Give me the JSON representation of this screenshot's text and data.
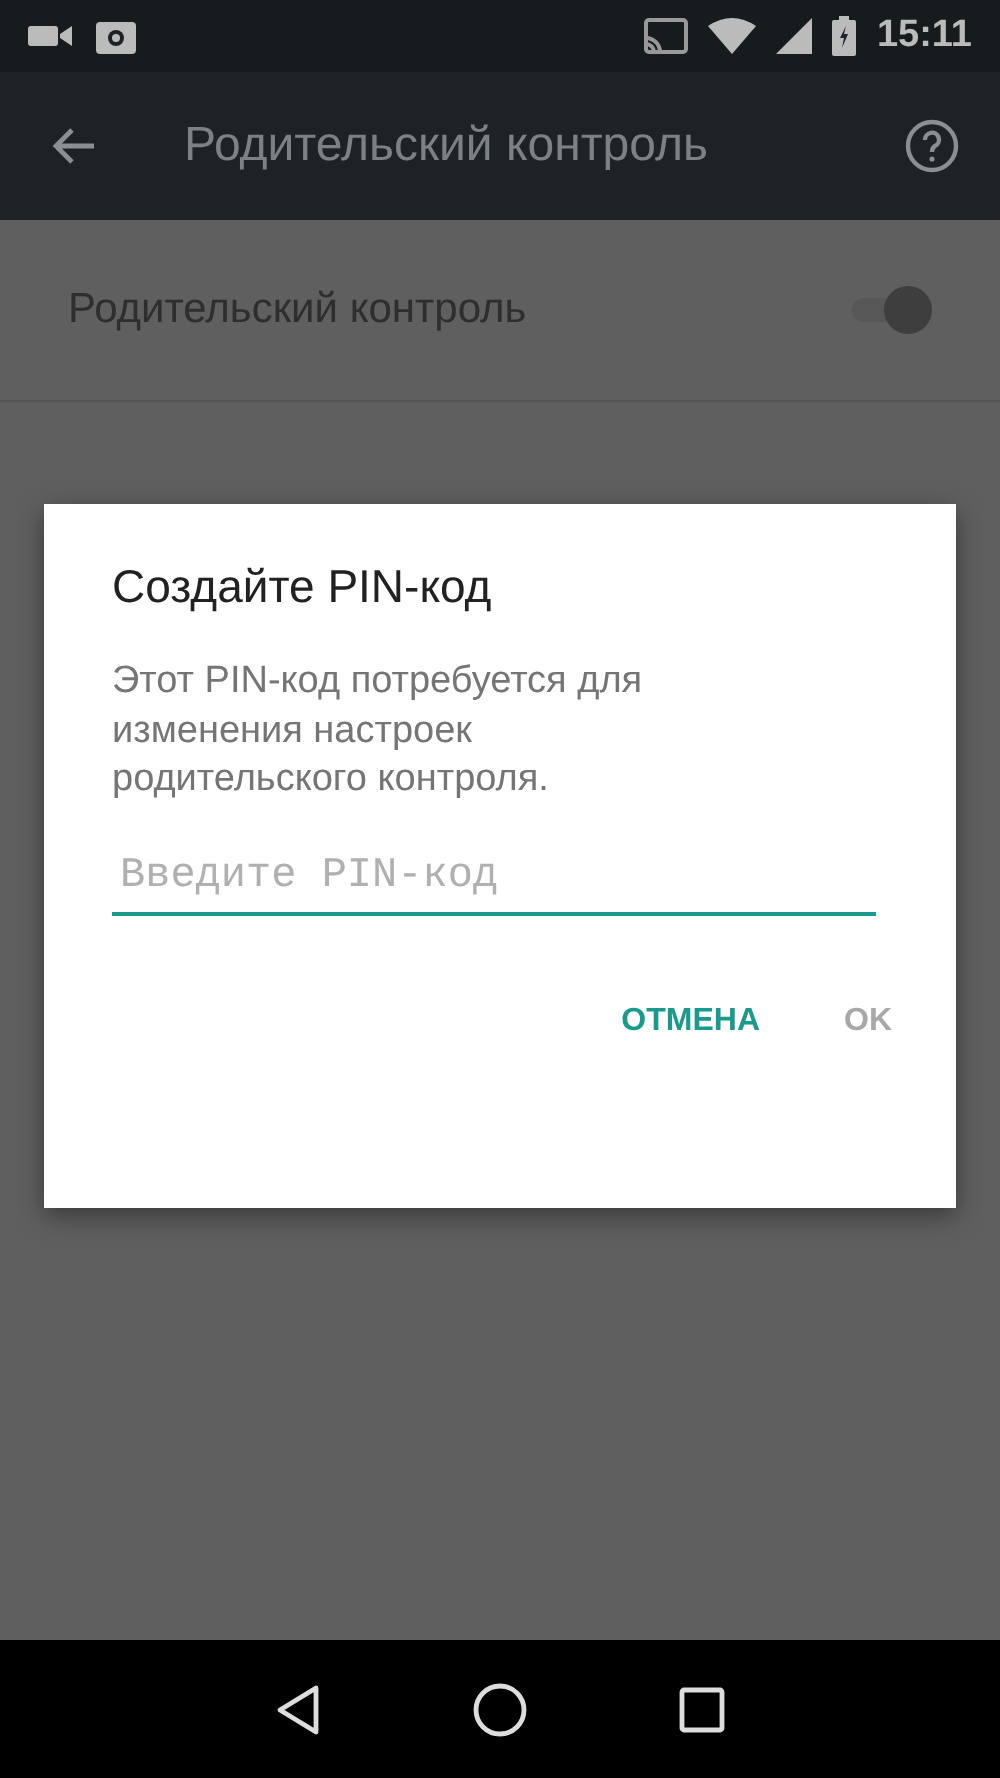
{
  "status_bar": {
    "time": "15:11"
  },
  "toolbar": {
    "title": "Родительский контроль"
  },
  "settings": [
    {
      "kind": "switch",
      "label": "Родительский контроль",
      "on": true
    }
  ],
  "dialog": {
    "title": "Создайте PIN-код",
    "message": "Этот PIN-код потребуется для изменения настроек родительского контроля.",
    "input": {
      "placeholder": "Введите PIN-код"
    },
    "buttons": [
      {
        "label": "ОТМЕНА",
        "disabled": false
      },
      {
        "label": "OK",
        "disabled": true
      }
    ]
  }
}
